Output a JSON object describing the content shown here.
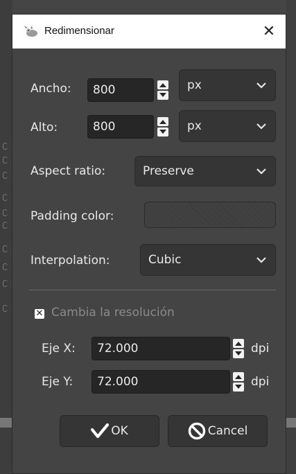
{
  "dialog": {
    "title": "Redimensionar",
    "close_glyph": "✕"
  },
  "size": {
    "width_label": "Ancho:",
    "width_value": "800",
    "width_unit": "px",
    "height_label": "Alto:",
    "height_value": "800",
    "height_unit": "px"
  },
  "aspect": {
    "label": "Aspect ratio:",
    "value": "Preserve"
  },
  "padding": {
    "label": "Padding color:"
  },
  "interpolation": {
    "label": "Interpolation:",
    "value": "Cubic"
  },
  "resolution": {
    "checkbox_label": "Cambia la resolución",
    "checked": true,
    "check_glyph": "✕",
    "x_label": "Eje X:",
    "x_value": "72.000",
    "x_unit": "dpi",
    "y_label": "Eje Y:",
    "y_value": "72.000",
    "y_unit": "dpi"
  },
  "buttons": {
    "ok_label": "OK",
    "cancel_label": "Cancel"
  },
  "icons": [
    "wilber-icon",
    "close-icon",
    "spin-arrows-icon",
    "chevron-down-icon",
    "check-icon",
    "checkmark-icon",
    "cancel-circle-icon"
  ]
}
